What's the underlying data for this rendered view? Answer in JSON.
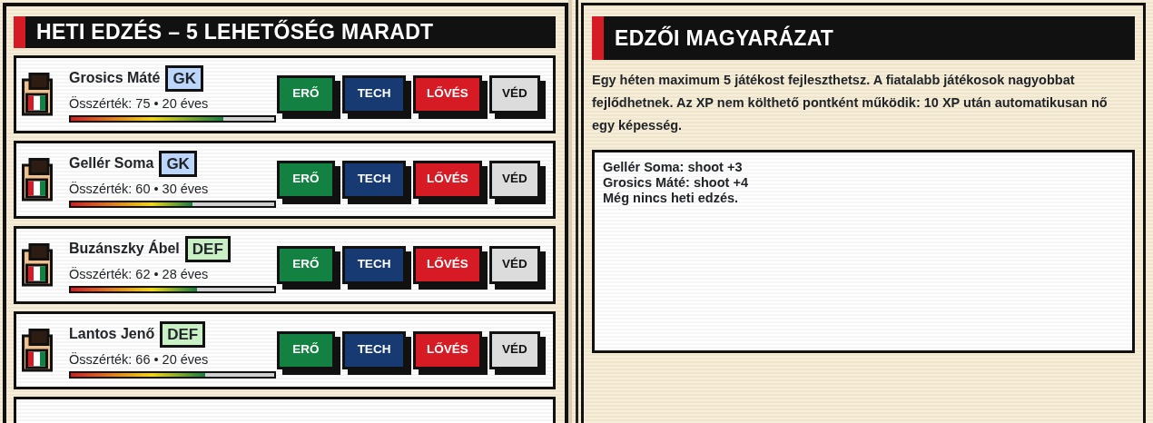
{
  "training": {
    "title": "HETI EDZÉS – 5 LEHETŐSÉG MARADT",
    "players": [
      {
        "name": "Grosics Máté",
        "position": "GK",
        "summary": "Összérték: 75 • 20 éves",
        "level": 0.75,
        "buttons": [
          {
            "label": "ERŐ",
            "kind": "power"
          },
          {
            "label": "TECH",
            "kind": "tech"
          },
          {
            "label": "LŐVÉS",
            "kind": "shoot"
          },
          {
            "label": "VÉD",
            "kind": "defense"
          }
        ]
      },
      {
        "name": "Gellér Soma",
        "position": "GK",
        "summary": "Összérték: 60 • 30 éves",
        "level": 0.6,
        "buttons": [
          {
            "label": "ERŐ",
            "kind": "power"
          },
          {
            "label": "TECH",
            "kind": "tech"
          },
          {
            "label": "LŐVÉS",
            "kind": "shoot"
          },
          {
            "label": "VÉD",
            "kind": "defense"
          }
        ]
      },
      {
        "name": "Buzánszky Ábel",
        "position": "DEF",
        "summary": "Összérték: 62 • 28 éves",
        "level": 0.62,
        "buttons": [
          {
            "label": "ERŐ",
            "kind": "power"
          },
          {
            "label": "TECH",
            "kind": "tech"
          },
          {
            "label": "LŐVÉS",
            "kind": "shoot"
          },
          {
            "label": "VÉD",
            "kind": "defense"
          }
        ]
      },
      {
        "name": "Lantos Jenő",
        "position": "DEF",
        "summary": "Összérték: 66 • 20 éves",
        "level": 0.66,
        "buttons": [
          {
            "label": "ERŐ",
            "kind": "power"
          },
          {
            "label": "TECH",
            "kind": "tech"
          },
          {
            "label": "LŐVÉS",
            "kind": "shoot"
          },
          {
            "label": "VÉD",
            "kind": "defense"
          }
        ]
      }
    ]
  },
  "explanation": {
    "title": "EDZŐI MAGYARÁZAT",
    "text": "Egy héten maximum 5 játékost fejleszthetsz. A fiatalabb játékosok nagyobbat fejlődhetnek. Az XP nem költhető pontként működik: 10 XP után automatikusan nő egy képesség.",
    "log": [
      "Gellér Soma: shoot +3",
      "Grosics Máté: shoot +4",
      "Még nincs heti edzés."
    ]
  }
}
